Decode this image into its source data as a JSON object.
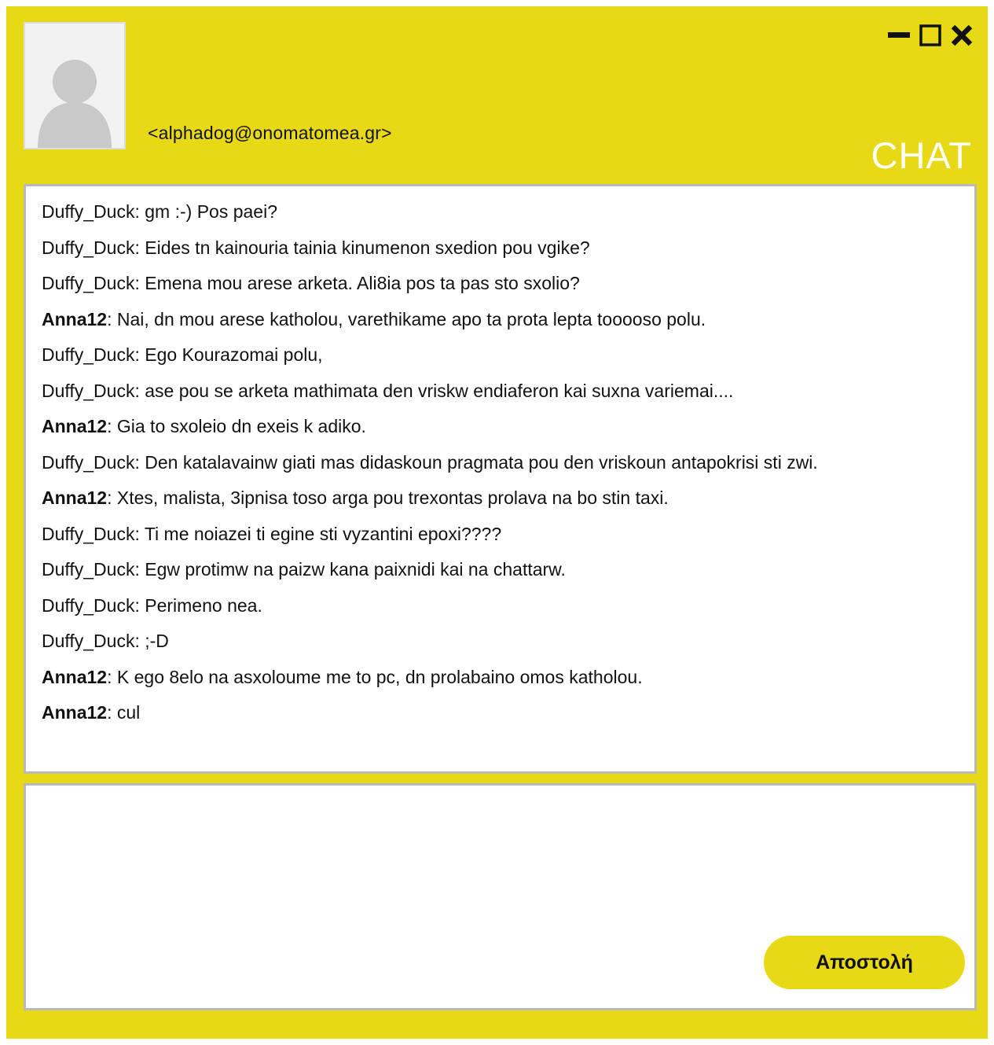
{
  "header": {
    "email": "<alphadog@onomatomea.gr>",
    "chat_title": "CHAT"
  },
  "icons": {
    "minimize": "minimize-icon",
    "maximize": "maximize-icon",
    "close": "close-icon",
    "avatar": "user-placeholder-icon"
  },
  "messages": [
    {
      "sender": "Duffy_Duck",
      "text": ": gm :-) Pos paei?",
      "bold": false
    },
    {
      "sender": "Duffy_Duck",
      "text": ": Eides tn kainouria tainia kinumenon sxedion pou vgike?",
      "bold": false
    },
    {
      "sender": "Duffy_Duck",
      "text": ": Emena mou arese arketa. Ali8ia pos ta pas sto sxolio?",
      "bold": false
    },
    {
      "sender": "Anna12",
      "text": ": Nai, dn mou arese katholou, varethikame apo ta prota lepta tooooso polu.",
      "bold": true
    },
    {
      "sender": "Duffy_Duck",
      "text": ": Ego Kourazomai polu,",
      "bold": false
    },
    {
      "sender": "Duffy_Duck",
      "text": ": ase pou se arketa mathimata den vriskw endiaferon kai suxna variemai....",
      "bold": false
    },
    {
      "sender": "Anna12",
      "text": ": Gia to sxoleio dn exeis k adiko.",
      "bold": true
    },
    {
      "sender": "Duffy_Duck",
      "text": ": Den katalavainw giati mas didaskoun pragmata pou den vriskoun antapokrisi sti zwi.",
      "bold": false
    },
    {
      "sender": "Anna12",
      "text": ": Xtes, malista, 3ipnisa toso arga pou trexontas prolava na bo stin taxi.",
      "bold": true
    },
    {
      "sender": "Duffy_Duck",
      "text": ": Ti me noiazei ti egine sti vyzantini epoxi????",
      "bold": false
    },
    {
      "sender": "Duffy_Duck",
      "text": ": Egw protimw na paizw kana paixnidi kai na chattarw.",
      "bold": false
    },
    {
      "sender": "Duffy_Duck",
      "text": ": Perimeno nea.",
      "bold": false
    },
    {
      "sender": "Duffy_Duck",
      "text": ": ;-D",
      "bold": false
    },
    {
      "sender": "Anna12",
      "text": ": K ego 8elo na asxoloume me to pc, dn prolabaino omos katholou.",
      "bold": true
    },
    {
      "sender": "Anna12",
      "text": ": cul",
      "bold": true
    }
  ],
  "compose": {
    "value": "",
    "send_label": "Αποστολή"
  },
  "colors": {
    "window_bg": "#e8d916",
    "panel_border": "#b9b9b9",
    "title_text": "#ffffff"
  }
}
